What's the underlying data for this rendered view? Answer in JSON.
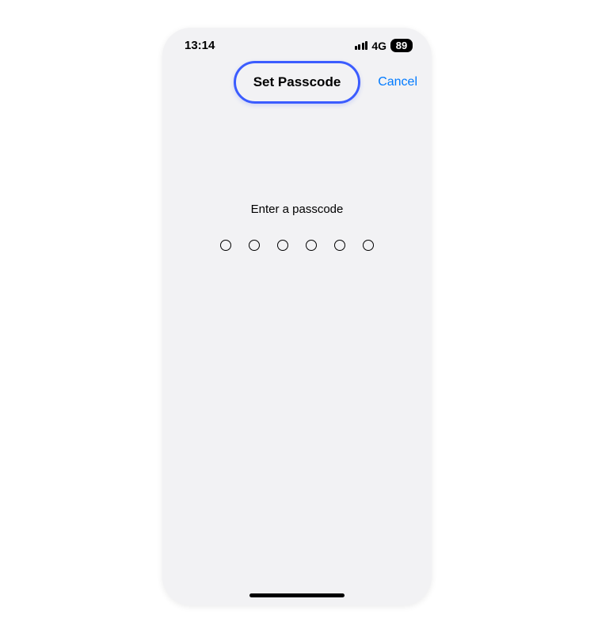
{
  "statusBar": {
    "time": "13:14",
    "network": "4G",
    "battery": "89"
  },
  "navBar": {
    "title": "Set Passcode",
    "cancel": "Cancel"
  },
  "content": {
    "prompt": "Enter a passcode",
    "passcodeLength": 6
  }
}
